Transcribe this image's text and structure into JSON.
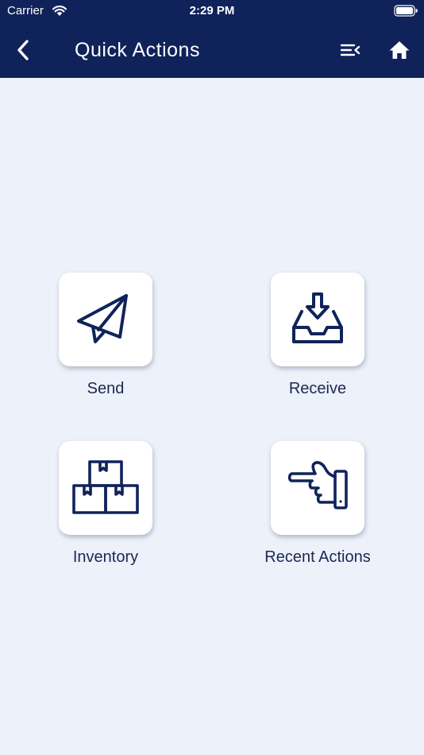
{
  "status_bar": {
    "carrier": "Carrier",
    "time": "2:29 PM",
    "icons": [
      "wifi-icon",
      "battery-icon"
    ]
  },
  "nav": {
    "title": "Quick Actions",
    "back_icon": "chevron-left-icon",
    "menu_icon": "menu-collapse-icon",
    "home_icon": "home-icon"
  },
  "actions": [
    {
      "label": "Send",
      "icon": "paper-plane-icon"
    },
    {
      "label": "Receive",
      "icon": "inbox-download-icon"
    },
    {
      "label": "Inventory",
      "icon": "boxes-icon"
    },
    {
      "label": "Recent Actions",
      "icon": "pointing-hand-icon"
    }
  ],
  "colors": {
    "header": "#0f2259",
    "background": "#ecf1fa",
    "tile": "#ffffff",
    "icon": "#10235a",
    "label": "#1c2852"
  }
}
